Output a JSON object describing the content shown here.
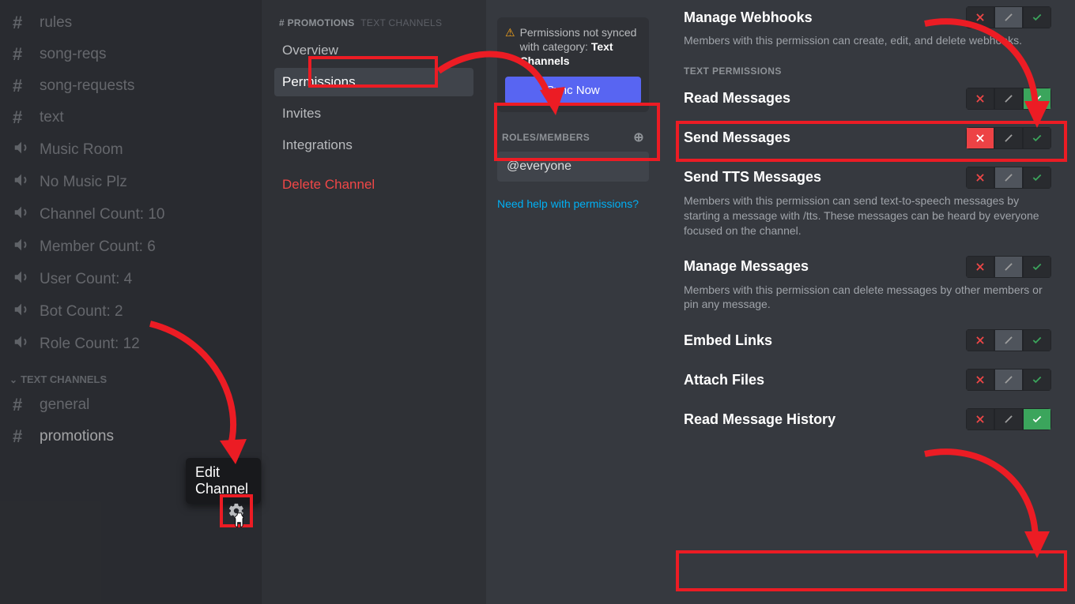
{
  "sidebar": {
    "channels_top": [
      {
        "type": "text",
        "label": "rules"
      },
      {
        "type": "text",
        "label": "song-reqs"
      },
      {
        "type": "text",
        "label": "song-requests"
      },
      {
        "type": "text",
        "label": "text"
      },
      {
        "type": "voice",
        "label": "Music Room"
      },
      {
        "type": "voice",
        "label": "No Music Plz"
      },
      {
        "type": "voice",
        "label": "Channel Count: 10"
      },
      {
        "type": "voice",
        "label": "Member Count: 6"
      },
      {
        "type": "voice",
        "label": "User Count: 4"
      },
      {
        "type": "voice",
        "label": "Bot Count: 2"
      },
      {
        "type": "voice",
        "label": "Role Count: 12"
      }
    ],
    "category_label": "Text Channels",
    "category_channels": [
      {
        "label": "general"
      },
      {
        "label": "promotions"
      }
    ],
    "tooltip": "Edit Channel"
  },
  "settings_nav": {
    "category_prefix": "# PROMOTIONS",
    "category_suffix": "TEXT CHANNELS",
    "items": [
      "Overview",
      "Permissions",
      "Invites",
      "Integrations"
    ],
    "delete": "Delete Channel"
  },
  "roles_panel": {
    "sync_msg_a": "Permissions not synced with category: ",
    "sync_msg_b": "Text Channels",
    "sync_btn": "Sync Now",
    "header": "ROLES/MEMBERS",
    "role": "@everyone",
    "help": "Need help with permissions?"
  },
  "perms": {
    "webhooks": {
      "title": "Manage Webhooks",
      "desc": "Members with this permission can create, edit, and delete webhooks."
    },
    "section_label": "TEXT PERMISSIONS",
    "rows": [
      {
        "key": "read",
        "title": "Read Messages",
        "state": "allow"
      },
      {
        "key": "send",
        "title": "Send Messages",
        "state": "deny"
      },
      {
        "key": "tts",
        "title": "Send TTS Messages",
        "state": "neutral",
        "desc": "Members with this permission can send text-to-speech messages by starting a message with /tts. These messages can be heard by everyone focused on the channel."
      },
      {
        "key": "manage",
        "title": "Manage Messages",
        "state": "neutral",
        "desc": "Members with this permission can delete messages by other members or pin any message."
      },
      {
        "key": "embed",
        "title": "Embed Links",
        "state": "neutral"
      },
      {
        "key": "attach",
        "title": "Attach Files",
        "state": "neutral"
      },
      {
        "key": "history",
        "title": "Read Message History",
        "state": "allow"
      }
    ]
  }
}
